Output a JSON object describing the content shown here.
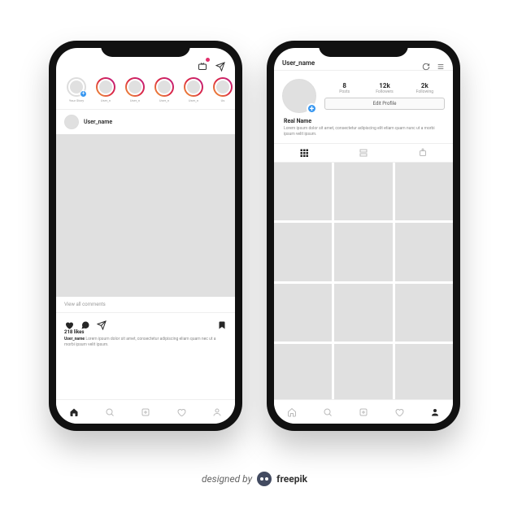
{
  "feed": {
    "stories": {
      "self_label": "Your Story",
      "items": [
        {
          "label": "User_n"
        },
        {
          "label": "User_n"
        },
        {
          "label": "User_n"
        },
        {
          "label": "User_n"
        },
        {
          "label": "Us"
        }
      ]
    },
    "post": {
      "username": "User_name",
      "likes_text": "218 likes",
      "caption_user": "User_name",
      "caption_text": "Lorem ipsum dolor sit amet, consectetur adipiscing eliam quam nec ut a morbi ipsum velit ipsum.",
      "view_comments": "View all comments"
    }
  },
  "profile": {
    "username": "User_name",
    "stats": {
      "posts": {
        "num": "8",
        "label": "Posts"
      },
      "followers": {
        "num": "12k",
        "label": "Followers"
      },
      "following": {
        "num": "2k",
        "label": "Following"
      }
    },
    "edit_button": "Edit Profile",
    "real_name": "Real Name",
    "bio_text": "Lorem ipsum dolor sit amet, consectetur adipiscing elit etiam quam nunc ut a morbi ipsum velit ipsum."
  },
  "attribution": {
    "prefix": "designed by",
    "brand": "freepik"
  }
}
